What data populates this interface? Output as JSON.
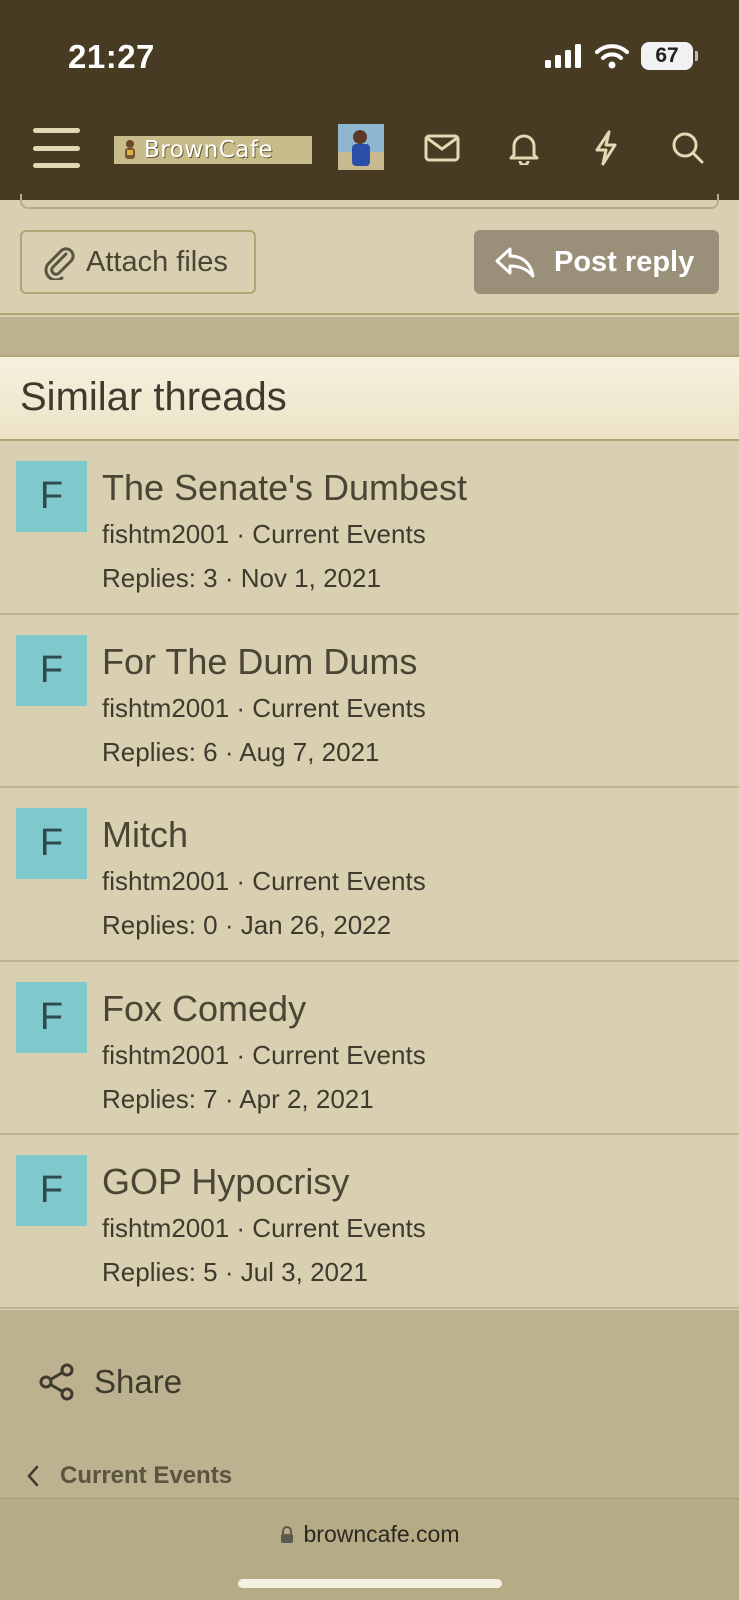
{
  "status_bar": {
    "time": "21:27",
    "battery": "67"
  },
  "header": {
    "logo_text": "BrownCafe"
  },
  "reply_bar": {
    "attach_label": "Attach files",
    "post_label": "Post reply"
  },
  "similar": {
    "title": "Similar threads",
    "threads": [
      {
        "initial": "F",
        "title": "The Senate's Dumbest",
        "meta": "fishtm2001 · Current Events",
        "stats": "Replies: 3 · Nov 1, 2021"
      },
      {
        "initial": "F",
        "title": "For The Dum Dums",
        "meta": "fishtm2001 · Current Events",
        "stats": "Replies: 6 · Aug 7, 2021"
      },
      {
        "initial": "F",
        "title": "Mitch",
        "meta": "fishtm2001 · Current Events",
        "stats": "Replies: 0 · Jan 26, 2022"
      },
      {
        "initial": "F",
        "title": "Fox Comedy",
        "meta": "fishtm2001 · Current Events",
        "stats": "Replies: 7 · Apr 2, 2021"
      },
      {
        "initial": "F",
        "title": "GOP Hypocrisy",
        "meta": "fishtm2001 · Current Events",
        "stats": "Replies: 5 · Jul 3, 2021"
      }
    ]
  },
  "footer": {
    "share_label": "Share",
    "breadcrumb_label": "Current Events"
  },
  "browser": {
    "url": "browncafe.com"
  },
  "colors": {
    "header_bg": "#473b24",
    "page_bg": "#d8d0b1",
    "avatar_bg": "#7fc8cc",
    "post_button": "#9a8f79"
  }
}
